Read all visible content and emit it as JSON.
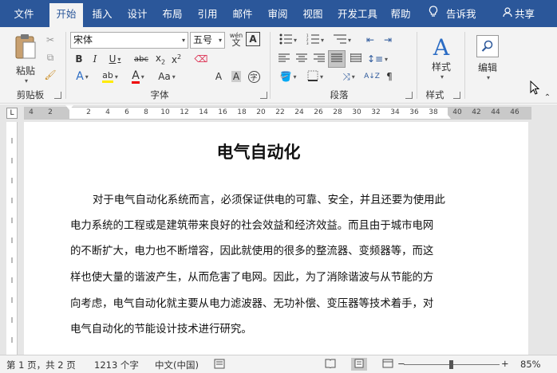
{
  "tabs": [
    {
      "label": "文件"
    },
    {
      "label": "开始"
    },
    {
      "label": "插入"
    },
    {
      "label": "设计"
    },
    {
      "label": "布局"
    },
    {
      "label": "引用"
    },
    {
      "label": "邮件"
    },
    {
      "label": "审阅"
    },
    {
      "label": "视图"
    },
    {
      "label": "开发工具"
    },
    {
      "label": "帮助"
    }
  ],
  "tell_me": "告诉我",
  "share": "共享",
  "ribbon": {
    "clipboard": {
      "paste_label": "粘贴",
      "group_label": "剪贴板"
    },
    "font": {
      "font_name": "宋体",
      "font_size": "五号",
      "wen_label": "wén",
      "group_label": "字体"
    },
    "paragraph": {
      "group_label": "段落"
    },
    "styles": {
      "styles_label": "样式",
      "group_label": "样式"
    },
    "editing": {
      "edit_label": "编辑"
    }
  },
  "ruler_numbers": [
    "4",
    "2",
    "2",
    "4",
    "6",
    "8",
    "10",
    "12",
    "14",
    "16",
    "18",
    "20",
    "22",
    "24",
    "26",
    "28",
    "30",
    "32",
    "34",
    "36",
    "38",
    "40",
    "42",
    "44",
    "46"
  ],
  "document": {
    "title": "电气自动化",
    "lines": [
      "对于电气自动化系统而言，必须保证供电的可靠、安全，并且还要为使用此",
      "电力系统的工程或是建筑带来良好的社会效益和经济效益。而且由于城市电网",
      "的不断扩大，电力也不断增容，因此就使用的很多的整流器、变频器等，而这",
      "样也使大量的谐波产生，从而危害了电网。因此，为了消除谐波与从节能的方",
      "向考虑，电气自动化就主要从电力滤波器、无功补偿、变压器等技术着手，对",
      "电气自动化的节能设计技术进行研究。"
    ]
  },
  "status": {
    "page": "第 1 页，共 2 页",
    "words": "1213 个字",
    "language": "中文(中国)",
    "zoom": "85%"
  }
}
